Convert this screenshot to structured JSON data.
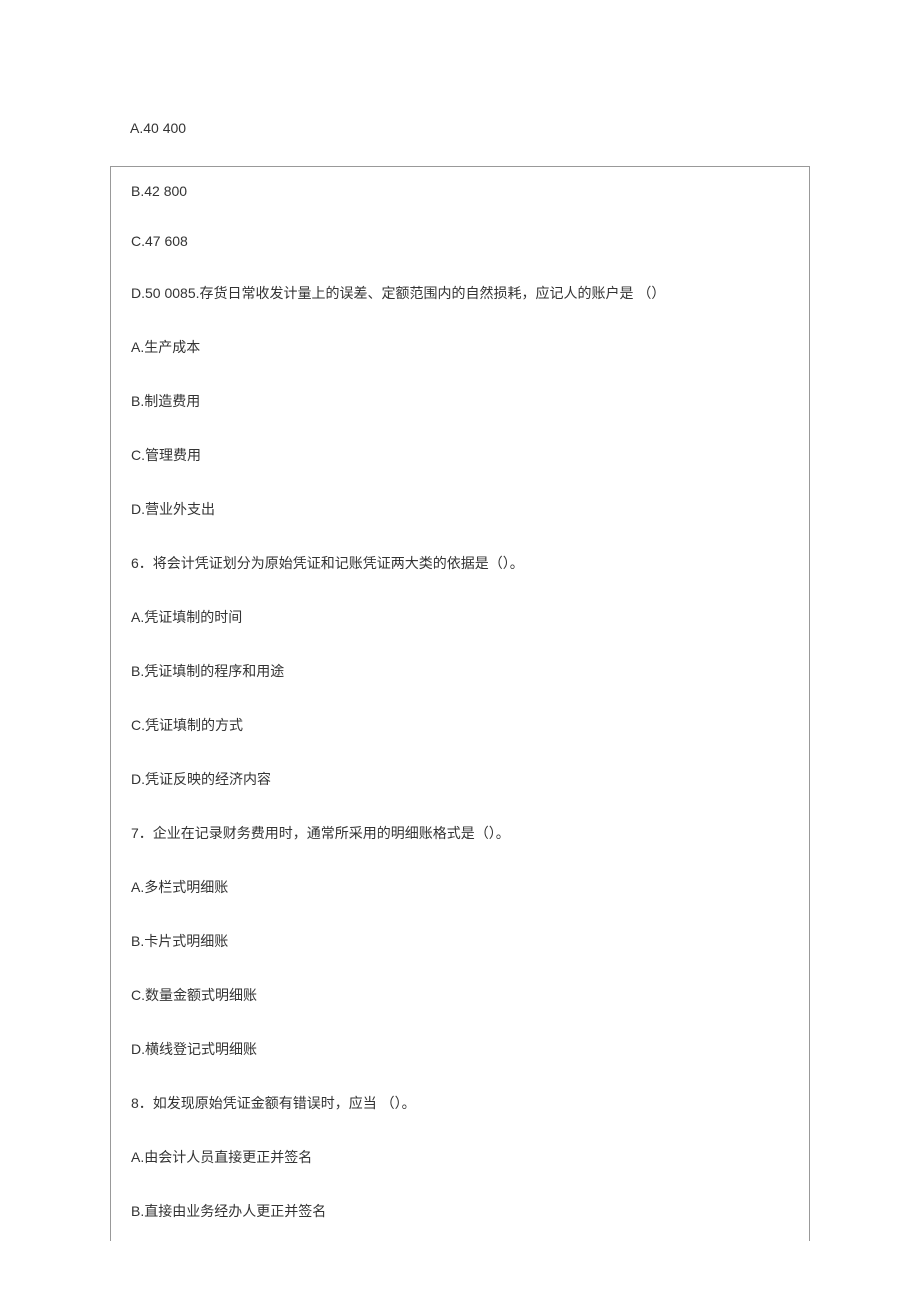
{
  "top_line": "A.40 400",
  "lines": [
    "B.42 800",
    "C.47 608",
    "D.50 0085.存货日常收发计量上的误差、定额范围内的自然损耗，应记人的账户是 （）",
    "A.生产成本",
    "B.制造费用",
    "C.管理费用",
    "D.营业外支出",
    "6．将会计凭证划分为原始凭证和记账凭证两大类的依据是（）。",
    "A.凭证填制的时间",
    "B.凭证填制的程序和用途",
    "C.凭证填制的方式",
    "D.凭证反映的经济内容",
    "7．企业在记录财务费用时，通常所采用的明细账格式是（）。",
    "A.多栏式明细账",
    "B.卡片式明细账",
    "C.数量金额式明细账",
    "D.横线登记式明细账",
    "8．如发现原始凭证金额有错误时，应当 （）。",
    "A.由会计人员直接更正并签名",
    "B.直接由业务经办人更正并签名"
  ]
}
